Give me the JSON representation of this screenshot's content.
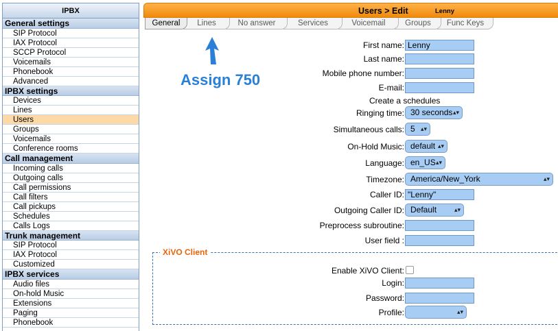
{
  "sidebar": {
    "title": "IPBX",
    "sections": [
      {
        "heading": "General settings",
        "items": [
          "SIP Protocol",
          "IAX Protocol",
          "SCCP Protocol",
          "Voicemails",
          "Phonebook",
          "Advanced"
        ]
      },
      {
        "heading": "IPBX settings",
        "items": [
          "Devices",
          "Lines",
          "Users",
          "Groups",
          "Voicemails",
          "Conference rooms"
        ]
      },
      {
        "heading": "Call management",
        "items": [
          "Incoming calls",
          "Outgoing calls",
          "Call permissions",
          "Call filters",
          "Call pickups",
          "Schedules",
          "Calls Logs"
        ]
      },
      {
        "heading": "Trunk management",
        "items": [
          "SIP Protocol",
          "IAX Protocol",
          "Customized"
        ]
      },
      {
        "heading": "IPBX services",
        "items": [
          "Audio files",
          "On-hold Music",
          "Extensions",
          "Paging",
          "Phonebook"
        ]
      }
    ],
    "active_item": "Users"
  },
  "header": {
    "title": "Users > Edit",
    "user": "Lenny"
  },
  "tabs": [
    "General",
    "Lines",
    "No answer",
    "Services",
    "Voicemail",
    "Groups",
    "Func Keys"
  ],
  "active_tab": "General",
  "annotation": {
    "text": "Assign 750",
    "color": "#2a7fd6"
  },
  "form": {
    "first_name": {
      "label": "First name:",
      "value": "Lenny"
    },
    "last_name": {
      "label": "Last name:",
      "value": ""
    },
    "mobile": {
      "label": "Mobile phone number:",
      "value": ""
    },
    "email": {
      "label": "E-mail:",
      "value": ""
    },
    "create_schedules": "Create a schedules",
    "ringing_time": {
      "label": "Ringing time:",
      "value": "30 seconds"
    },
    "simultaneous_calls": {
      "label": "Simultaneous calls:",
      "value": "5"
    },
    "on_hold_music": {
      "label": "On-Hold Music:",
      "value": "default"
    },
    "language": {
      "label": "Language:",
      "value": "en_US"
    },
    "timezone": {
      "label": "Timezone:",
      "value": "America/New_York"
    },
    "caller_id": {
      "label": "Caller ID:",
      "value": "\"Lenny\""
    },
    "outgoing_caller_id": {
      "label": "Outgoing Caller ID:",
      "value": "Default"
    },
    "preprocess_subroutine": {
      "label": "Preprocess subroutine:",
      "value": ""
    },
    "user_field": {
      "label": "User field :",
      "value": ""
    }
  },
  "xivo_client": {
    "legend": "XiVO Client",
    "enable": {
      "label": "Enable XiVO Client:",
      "checked": false
    },
    "login": {
      "label": "Login:",
      "value": ""
    },
    "password": {
      "label": "Password:",
      "value": ""
    },
    "profile": {
      "label": "Profile:",
      "value": ""
    }
  },
  "colors": {
    "header_orange": "#f08a0b",
    "input_blue": "#a8cdf5",
    "active_item": "#fcd9a7",
    "legend_orange": "#e8650a"
  }
}
